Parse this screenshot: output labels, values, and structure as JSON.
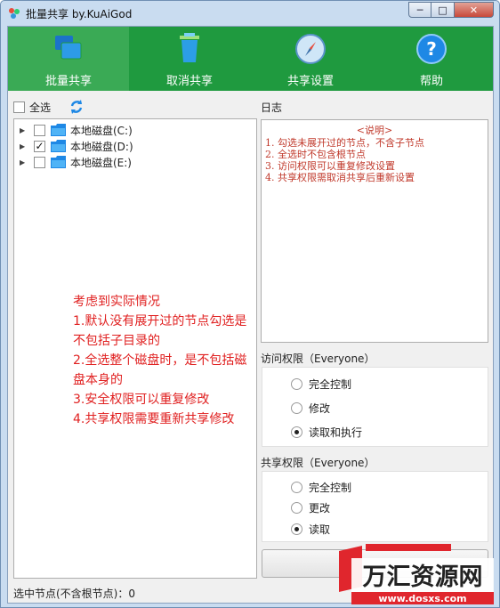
{
  "window": {
    "title": "批量共享 by.KuAiGod",
    "controls": {
      "minimize": "─",
      "maximize": "□",
      "close": "✕"
    }
  },
  "toolbar": {
    "items": [
      {
        "label": "批量共享",
        "icon": "share-windows-icon"
      },
      {
        "label": "取消共享",
        "icon": "trash-icon"
      },
      {
        "label": "共享设置",
        "icon": "compass-icon"
      },
      {
        "label": "帮助",
        "icon": "help-icon"
      }
    ]
  },
  "tree": {
    "select_all": "全选",
    "nodes": [
      {
        "name": "本地磁盘(C:)",
        "checked": false
      },
      {
        "name": "本地磁盘(D:)",
        "checked": true
      },
      {
        "name": "本地磁盘(E:)",
        "checked": false
      }
    ]
  },
  "annotation": {
    "lines": [
      "考虑到实际情况",
      "1.默认没有展开过的节点勾选是不包括子目录的",
      "2.全选整个磁盘时，是不包括磁盘本身的",
      "3.安全权限可以重复修改",
      "4.共享权限需要重新共享修改"
    ]
  },
  "log": {
    "title": "日志",
    "heading": "<说明>",
    "lines": [
      "1. 勾选未展开过的节点，不含子节点",
      "2. 全选时不包含根节点",
      "3. 访问权限可以重复修改设置",
      "4. 共享权限需取消共享后重新设置"
    ]
  },
  "access": {
    "title": "访问权限（Everyone）",
    "options": [
      "完全控制",
      "修改",
      "读取和执行"
    ],
    "selected": 2
  },
  "share": {
    "title": "共享权限（Everyone）",
    "options": [
      "完全控制",
      "更改",
      "读取"
    ],
    "selected": 2
  },
  "status": {
    "text": "选中节点(不含根节点)：0"
  },
  "watermark": {
    "brand": "万汇资源网",
    "url": "www.dosxs.com"
  },
  "colors": {
    "toolbar": "#1f9a3f",
    "toolbar_active": "#3aaa55",
    "note": "#e02020",
    "log_text": "#c0392b"
  }
}
